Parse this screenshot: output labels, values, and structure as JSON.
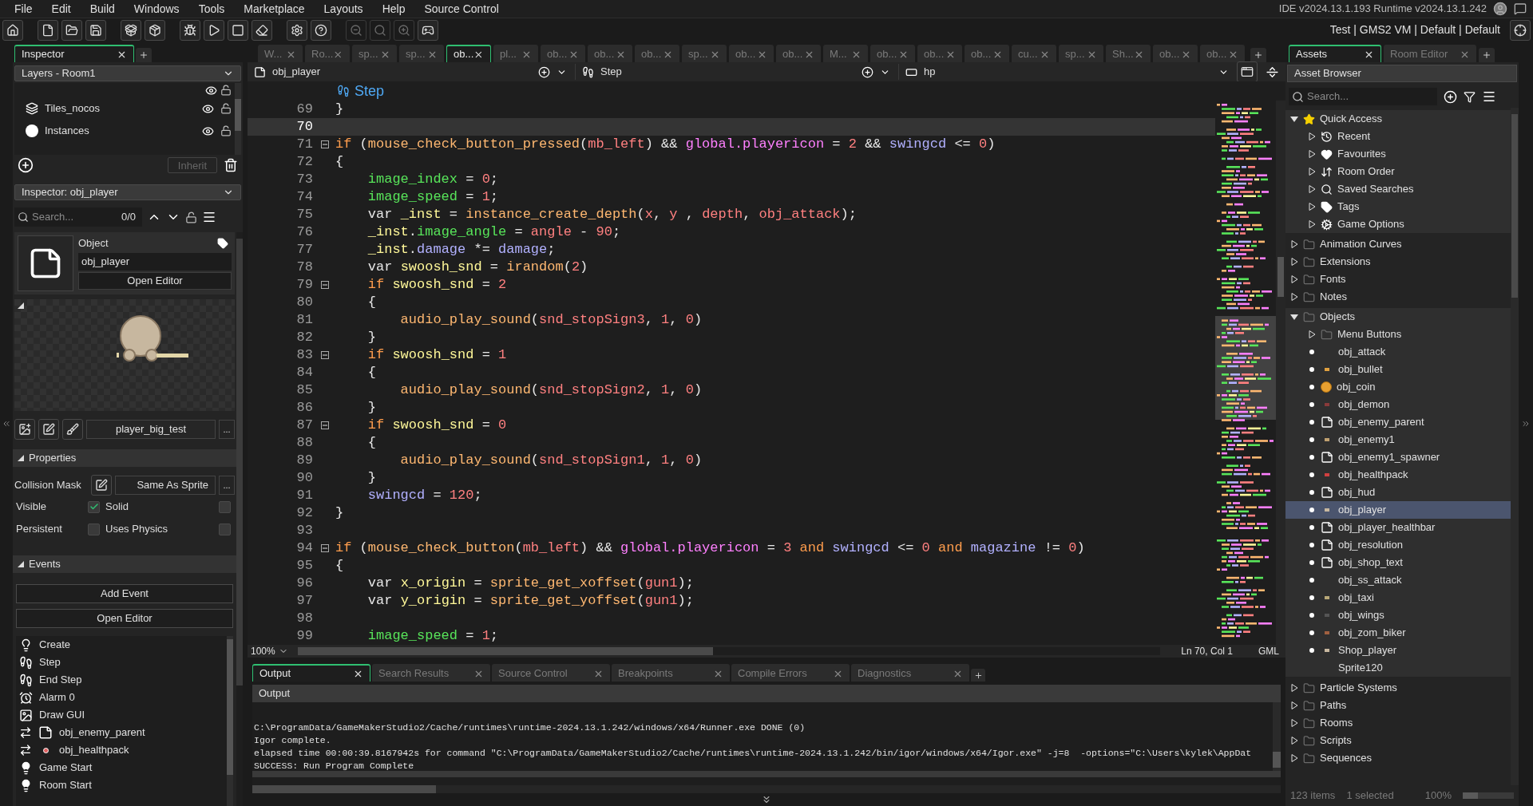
{
  "menu": [
    "File",
    "Edit",
    "Build",
    "Windows",
    "Tools",
    "Marketplace",
    "Layouts",
    "Help",
    "Source Control"
  ],
  "version": "IDE v2024.13.1.193  Runtime v2024.13.1.242",
  "targets": "Test | GMS2 VM | Default | Default",
  "left_panel": {
    "tabs": [
      {
        "label": "Inspector",
        "selected": true
      }
    ],
    "layers_dropdown": "Layers - Room1",
    "layers": [
      {
        "name": "Tiles_nocos",
        "kind": "tiles"
      },
      {
        "name": "Instances",
        "kind": "instances"
      }
    ],
    "inherit_button": {
      "label": "Inherit",
      "disabled": true
    },
    "inspector_dropdown": "Inspector: obj_player",
    "search": {
      "placeholder": "Search...",
      "count": "0/0"
    },
    "object": {
      "type_label": "Object",
      "name": "obj_player",
      "open_button": "Open Editor"
    },
    "sprite_button": "player_big_test",
    "sprite_more": "...",
    "properties": {
      "title": "Properties",
      "expanded": true,
      "collision_label": "Collision Mask",
      "collision_value": "Same As Sprite",
      "collision_more": "...",
      "checks": [
        {
          "label": "Visible",
          "checked": true
        },
        {
          "label": "Solid",
          "checked": false
        },
        {
          "label": "Persistent",
          "checked": false
        },
        {
          "label": "Uses Physics",
          "checked": false
        }
      ]
    },
    "events": {
      "title": "Events",
      "expanded": true,
      "add_button": "Add Event",
      "open_button": "Open Editor",
      "items": [
        {
          "label": "Create",
          "kind": "create"
        },
        {
          "label": "Step",
          "kind": "step"
        },
        {
          "label": "End Step",
          "kind": "step"
        },
        {
          "label": "Alarm 0",
          "kind": "alarm"
        },
        {
          "label": "Draw GUI",
          "kind": "draw"
        },
        {
          "label": "obj_enemy_parent",
          "kind": "collision-object"
        },
        {
          "label": "obj_healthpack",
          "kind": "collision-sprite"
        },
        {
          "label": "Game Start",
          "kind": "other"
        },
        {
          "label": "Room Start",
          "kind": "other"
        }
      ]
    }
  },
  "editor": {
    "tabs": [
      {
        "label": "W...",
        "selected": false
      },
      {
        "label": "Ro...",
        "selected": false
      },
      {
        "label": "sp...",
        "selected": false
      },
      {
        "label": "sp...",
        "selected": false
      },
      {
        "label": "ob...",
        "selected": true
      },
      {
        "label": "pl...",
        "selected": false
      },
      {
        "label": "ob...",
        "selected": false
      },
      {
        "label": "ob...",
        "selected": false
      },
      {
        "label": "ob...",
        "selected": false
      },
      {
        "label": "sp...",
        "selected": false
      },
      {
        "label": "ob...",
        "selected": false
      },
      {
        "label": "ob...",
        "selected": false
      },
      {
        "label": "M...",
        "selected": false
      },
      {
        "label": "ob...",
        "selected": false
      },
      {
        "label": "ob...",
        "selected": false
      },
      {
        "label": "ob...",
        "selected": false
      },
      {
        "label": "cu...",
        "selected": false
      },
      {
        "label": "sp...",
        "selected": false
      },
      {
        "label": "Sh...",
        "selected": false
      },
      {
        "label": "ob...",
        "selected": false
      },
      {
        "label": "ob...",
        "selected": false
      }
    ],
    "object_name": "obj_player",
    "event_name": "Step",
    "variable": "hp",
    "step_title": "Step",
    "lines": [
      {
        "number": "69",
        "current": false,
        "foldable": false,
        "tokens": [
          {
            "text": "}",
            "kind": "plain"
          }
        ]
      },
      {
        "number": "70",
        "current": true,
        "foldable": false
      },
      {
        "number": "71",
        "current": false,
        "foldable": true,
        "tokens": [
          {
            "text": "if",
            "kind": "keyword"
          },
          {
            "text": " (",
            "kind": "plain"
          },
          {
            "text": "mouse_check_button_pressed",
            "kind": "func"
          },
          {
            "text": "(",
            "kind": "plain"
          },
          {
            "text": "mb_left",
            "kind": "constant"
          },
          {
            "text": ") && ",
            "kind": "plain"
          },
          {
            "text": "global.playericon",
            "kind": "global"
          },
          {
            "text": " = ",
            "kind": "plain"
          },
          {
            "text": "2",
            "kind": "number"
          },
          {
            "text": " && ",
            "kind": "plain"
          },
          {
            "text": "swingcd",
            "kind": "instance"
          },
          {
            "text": " <= ",
            "kind": "plain"
          },
          {
            "text": "0",
            "kind": "number"
          },
          {
            "text": ")",
            "kind": "plain"
          }
        ]
      },
      {
        "number": "72",
        "current": false,
        "foldable": false,
        "tokens": [
          {
            "text": "{",
            "kind": "plain"
          }
        ]
      },
      {
        "number": "73",
        "current": false,
        "foldable": false,
        "tokens": [
          {
            "text": "    image_index",
            "kind": "builtin"
          },
          {
            "text": " = ",
            "kind": "plain"
          },
          {
            "text": "0",
            "kind": "number"
          },
          {
            "text": ";",
            "kind": "plain"
          }
        ]
      },
      {
        "number": "74",
        "current": false,
        "foldable": false,
        "tokens": [
          {
            "text": "    image_speed",
            "kind": "builtin"
          },
          {
            "text": " = ",
            "kind": "plain"
          },
          {
            "text": "1",
            "kind": "number"
          },
          {
            "text": ";",
            "kind": "plain"
          }
        ]
      },
      {
        "number": "75",
        "current": false,
        "foldable": false,
        "tokens": [
          {
            "text": "    var ",
            "kind": "plain"
          },
          {
            "text": "_inst",
            "kind": "local"
          },
          {
            "text": " = ",
            "kind": "plain"
          },
          {
            "text": "instance_create_depth",
            "kind": "func"
          },
          {
            "text": "(",
            "kind": "plain"
          },
          {
            "text": "x",
            "kind": "constant"
          },
          {
            "text": ", ",
            "kind": "plain"
          },
          {
            "text": "y",
            "kind": "constant"
          },
          {
            "text": " , ",
            "kind": "plain"
          },
          {
            "text": "depth",
            "kind": "constant"
          },
          {
            "text": ", ",
            "kind": "plain"
          },
          {
            "text": "obj_attack",
            "kind": "constant"
          },
          {
            "text": ");",
            "kind": "plain"
          }
        ]
      },
      {
        "number": "76",
        "current": false,
        "foldable": false,
        "tokens": [
          {
            "text": "    _inst",
            "kind": "local"
          },
          {
            "text": ".",
            "kind": "plain"
          },
          {
            "text": "image_angle",
            "kind": "builtin"
          },
          {
            "text": " = ",
            "kind": "plain"
          },
          {
            "text": "angle",
            "kind": "constant"
          },
          {
            "text": " - ",
            "kind": "plain"
          },
          {
            "text": "90",
            "kind": "number"
          },
          {
            "text": ";",
            "kind": "plain"
          }
        ]
      },
      {
        "number": "77",
        "current": false,
        "foldable": false,
        "tokens": [
          {
            "text": "    _inst",
            "kind": "local"
          },
          {
            "text": ".",
            "kind": "plain"
          },
          {
            "text": "damage",
            "kind": "instance"
          },
          {
            "text": " *= ",
            "kind": "plain"
          },
          {
            "text": "damage",
            "kind": "instance"
          },
          {
            "text": ";",
            "kind": "plain"
          }
        ]
      },
      {
        "number": "78",
        "current": false,
        "foldable": false,
        "tokens": [
          {
            "text": "    var ",
            "kind": "plain"
          },
          {
            "text": "swoosh_snd",
            "kind": "local"
          },
          {
            "text": " = ",
            "kind": "plain"
          },
          {
            "text": "irandom",
            "kind": "func"
          },
          {
            "text": "(",
            "kind": "plain"
          },
          {
            "text": "2",
            "kind": "number"
          },
          {
            "text": ")",
            "kind": "plain"
          }
        ]
      },
      {
        "number": "79",
        "current": false,
        "foldable": true,
        "tokens": [
          {
            "text": "    if",
            "kind": "keyword"
          },
          {
            "text": " swoosh_snd",
            "kind": "local"
          },
          {
            "text": " = ",
            "kind": "plain"
          },
          {
            "text": "2",
            "kind": "number"
          }
        ]
      },
      {
        "number": "80",
        "current": false,
        "foldable": false,
        "tokens": [
          {
            "text": "    {",
            "kind": "plain"
          }
        ]
      },
      {
        "number": "81",
        "current": false,
        "foldable": false,
        "tokens": [
          {
            "text": "        audio_play_sound",
            "kind": "func"
          },
          {
            "text": "(",
            "kind": "plain"
          },
          {
            "text": "snd_stopSign3",
            "kind": "constant"
          },
          {
            "text": ", ",
            "kind": "plain"
          },
          {
            "text": "1",
            "kind": "number"
          },
          {
            "text": ", ",
            "kind": "plain"
          },
          {
            "text": "0",
            "kind": "number"
          },
          {
            "text": ")",
            "kind": "plain"
          }
        ]
      },
      {
        "number": "82",
        "current": false,
        "foldable": false,
        "tokens": [
          {
            "text": "    }",
            "kind": "plain"
          }
        ]
      },
      {
        "number": "83",
        "current": false,
        "foldable": true,
        "tokens": [
          {
            "text": "    if",
            "kind": "keyword"
          },
          {
            "text": " swoosh_snd",
            "kind": "local"
          },
          {
            "text": " = ",
            "kind": "plain"
          },
          {
            "text": "1",
            "kind": "number"
          }
        ]
      },
      {
        "number": "84",
        "current": false,
        "foldable": false,
        "tokens": [
          {
            "text": "    {",
            "kind": "plain"
          }
        ]
      },
      {
        "number": "85",
        "current": false,
        "foldable": false,
        "tokens": [
          {
            "text": "        audio_play_sound",
            "kind": "func"
          },
          {
            "text": "(",
            "kind": "plain"
          },
          {
            "text": "snd_stopSign2",
            "kind": "constant"
          },
          {
            "text": ", ",
            "kind": "plain"
          },
          {
            "text": "1",
            "kind": "number"
          },
          {
            "text": ", ",
            "kind": "plain"
          },
          {
            "text": "0",
            "kind": "number"
          },
          {
            "text": ")",
            "kind": "plain"
          }
        ]
      },
      {
        "number": "86",
        "current": false,
        "foldable": false,
        "tokens": [
          {
            "text": "    }",
            "kind": "plain"
          }
        ]
      },
      {
        "number": "87",
        "current": false,
        "foldable": true,
        "tokens": [
          {
            "text": "    if",
            "kind": "keyword"
          },
          {
            "text": " swoosh_snd",
            "kind": "local"
          },
          {
            "text": " = ",
            "kind": "plain"
          },
          {
            "text": "0",
            "kind": "number"
          }
        ]
      },
      {
        "number": "88",
        "current": false,
        "foldable": false,
        "tokens": [
          {
            "text": "    {",
            "kind": "plain"
          }
        ]
      },
      {
        "number": "89",
        "current": false,
        "foldable": false,
        "tokens": [
          {
            "text": "        audio_play_sound",
            "kind": "func"
          },
          {
            "text": "(",
            "kind": "plain"
          },
          {
            "text": "snd_stopSign1",
            "kind": "constant"
          },
          {
            "text": ", ",
            "kind": "plain"
          },
          {
            "text": "1",
            "kind": "number"
          },
          {
            "text": ", ",
            "kind": "plain"
          },
          {
            "text": "0",
            "kind": "number"
          },
          {
            "text": ")",
            "kind": "plain"
          }
        ]
      },
      {
        "number": "90",
        "current": false,
        "foldable": false,
        "tokens": [
          {
            "text": "    }",
            "kind": "plain"
          }
        ]
      },
      {
        "number": "91",
        "current": false,
        "foldable": false,
        "tokens": [
          {
            "text": "    swingcd",
            "kind": "instance"
          },
          {
            "text": " = ",
            "kind": "plain"
          },
          {
            "text": "120",
            "kind": "number"
          },
          {
            "text": ";",
            "kind": "plain"
          }
        ]
      },
      {
        "number": "92",
        "current": false,
        "foldable": false,
        "tokens": [
          {
            "text": "}",
            "kind": "plain"
          }
        ]
      },
      {
        "number": "93",
        "current": false,
        "foldable": false
      },
      {
        "number": "94",
        "current": false,
        "foldable": true,
        "tokens": [
          {
            "text": "if",
            "kind": "keyword"
          },
          {
            "text": " (",
            "kind": "plain"
          },
          {
            "text": "mouse_check_button",
            "kind": "func"
          },
          {
            "text": "(",
            "kind": "plain"
          },
          {
            "text": "mb_left",
            "kind": "constant"
          },
          {
            "text": ") && ",
            "kind": "plain"
          },
          {
            "text": "global.playericon",
            "kind": "global"
          },
          {
            "text": " = ",
            "kind": "plain"
          },
          {
            "text": "3",
            "kind": "number"
          },
          {
            "text": " and",
            "kind": "keyword"
          },
          {
            "text": " swingcd",
            "kind": "instance"
          },
          {
            "text": " <= ",
            "kind": "plain"
          },
          {
            "text": "0",
            "kind": "number"
          },
          {
            "text": " and",
            "kind": "keyword"
          },
          {
            "text": " magazine",
            "kind": "instance"
          },
          {
            "text": " != ",
            "kind": "plain"
          },
          {
            "text": "0",
            "kind": "number"
          },
          {
            "text": ")",
            "kind": "plain"
          }
        ]
      },
      {
        "number": "95",
        "current": false,
        "foldable": false,
        "tokens": [
          {
            "text": "{",
            "kind": "plain"
          }
        ]
      },
      {
        "number": "96",
        "current": false,
        "foldable": false,
        "tokens": [
          {
            "text": "    var ",
            "kind": "plain"
          },
          {
            "text": "x_origin",
            "kind": "local"
          },
          {
            "text": " = ",
            "kind": "plain"
          },
          {
            "text": "sprite_get_xoffset",
            "kind": "func"
          },
          {
            "text": "(",
            "kind": "plain"
          },
          {
            "text": "gun1",
            "kind": "constant"
          },
          {
            "text": ");",
            "kind": "plain"
          }
        ]
      },
      {
        "number": "97",
        "current": false,
        "foldable": false,
        "tokens": [
          {
            "text": "    var ",
            "kind": "plain"
          },
          {
            "text": "y_origin",
            "kind": "local"
          },
          {
            "text": " = ",
            "kind": "plain"
          },
          {
            "text": "sprite_get_yoffset",
            "kind": "func"
          },
          {
            "text": "(",
            "kind": "plain"
          },
          {
            "text": "gun1",
            "kind": "constant"
          },
          {
            "text": ");",
            "kind": "plain"
          }
        ]
      },
      {
        "number": "98",
        "current": false,
        "foldable": false
      },
      {
        "number": "99",
        "current": false,
        "foldable": false,
        "tokens": [
          {
            "text": "    image_speed",
            "kind": "builtin"
          },
          {
            "text": " = ",
            "kind": "plain"
          },
          {
            "text": "1",
            "kind": "number"
          },
          {
            "text": ";",
            "kind": "plain"
          }
        ]
      }
    ],
    "zoom": "100%",
    "position": "Ln 70, Col 1",
    "language": "GML"
  },
  "output": {
    "tabs": [
      {
        "label": "Output",
        "selected": true
      },
      {
        "label": "Search Results",
        "selected": false
      },
      {
        "label": "Source Control",
        "selected": false
      },
      {
        "label": "Breakpoints",
        "selected": false
      },
      {
        "label": "Compile Errors",
        "selected": false
      },
      {
        "label": "Diagnostics",
        "selected": false
      }
    ],
    "header": "Output",
    "lines": [
      "C:\\ProgramData/GameMakerStudio2/Cache/runtimes\\runtime-2024.13.1.242/windows/x64/Runner.exe DONE (0)",
      "Igor complete.",
      "elapsed time 00:00:39.8167942s for command \"C:\\ProgramData/GameMakerStudio2/Cache/runtimes\\runtime-2024.13.1.242/bin/igor/windows/x64/Igor.exe\" -j=8  -options=\"C:\\Users\\kylek\\AppDat",
      "SUCCESS: Run Program Complete"
    ]
  },
  "assets": {
    "tabs": [
      {
        "label": "Assets",
        "selected": true
      },
      {
        "label": "Room Editor",
        "selected": false
      }
    ],
    "header": "Asset Browser",
    "search_placeholder": "Search...",
    "tree": [
      {
        "label": "Quick Access",
        "kind": "quick",
        "expanded": true,
        "selected": false,
        "children": [
          {
            "label": "Recent",
            "kind": "recent",
            "expanded": false,
            "selected": false
          },
          {
            "label": "Favourites",
            "kind": "favourites",
            "expanded": false,
            "selected": false
          },
          {
            "label": "Room Order",
            "kind": "room-order",
            "expanded": false,
            "selected": false
          },
          {
            "label": "Saved Searches",
            "kind": "saved-searches",
            "expanded": false,
            "selected": false
          },
          {
            "label": "Tags",
            "kind": "tags",
            "expanded": false,
            "selected": false
          },
          {
            "label": "Game Options",
            "kind": "game-options",
            "expanded": false,
            "selected": false
          }
        ]
      },
      {
        "label": "Animation Curves",
        "kind": "folder",
        "expanded": false,
        "selected": false
      },
      {
        "label": "Extensions",
        "kind": "folder",
        "expanded": false,
        "selected": false
      },
      {
        "label": "Fonts",
        "kind": "folder",
        "expanded": false,
        "selected": false
      },
      {
        "label": "Notes",
        "kind": "folder",
        "expanded": false,
        "selected": false
      },
      {
        "label": "Objects",
        "kind": "folder",
        "expanded": true,
        "selected": false,
        "children": [
          {
            "label": "Menu Buttons",
            "kind": "folder",
            "expanded": false,
            "selected": false
          },
          {
            "label": "obj_attack",
            "kind": "object-plain",
            "selected": false
          },
          {
            "label": "obj_bullet",
            "kind": "object-sprite",
            "color": "#e0a040",
            "selected": false
          },
          {
            "label": "obj_coin",
            "kind": "object-coin",
            "selected": false
          },
          {
            "label": "obj_demon",
            "kind": "object-sprite",
            "color": "#8a3a3a",
            "selected": false
          },
          {
            "label": "obj_enemy_parent",
            "kind": "object",
            "selected": false
          },
          {
            "label": "obj_enemy1",
            "kind": "object-sprite",
            "color": "#c0a070",
            "selected": false
          },
          {
            "label": "obj_enemy1_spawner",
            "kind": "object",
            "selected": false
          },
          {
            "label": "obj_healthpack",
            "kind": "object-sprite",
            "color": "#d04040",
            "selected": false
          },
          {
            "label": "obj_hud",
            "kind": "object",
            "selected": false
          },
          {
            "label": "obj_player",
            "kind": "object-sprite",
            "color": "#c8b8a0",
            "selected": true
          },
          {
            "label": "obj_player_healthbar",
            "kind": "object",
            "selected": false
          },
          {
            "label": "obj_resolution",
            "kind": "object",
            "selected": false
          },
          {
            "label": "obj_shop_text",
            "kind": "object",
            "selected": false
          },
          {
            "label": "obj_ss_attack",
            "kind": "object-plain",
            "selected": false
          },
          {
            "label": "obj_taxi",
            "kind": "object-sprite",
            "color": "#b8a878",
            "selected": false
          },
          {
            "label": "obj_wings",
            "kind": "object-sprite",
            "color": "#555555",
            "selected": false
          },
          {
            "label": "obj_zom_biker",
            "kind": "object-sprite",
            "color": "#a06040",
            "selected": false
          },
          {
            "label": "Shop_player",
            "kind": "object-sprite",
            "color": "#c8b8a0",
            "selected": false
          },
          {
            "label": "Sprite120",
            "kind": "sprite",
            "selected": false
          }
        ]
      },
      {
        "label": "Particle Systems",
        "kind": "folder",
        "expanded": false,
        "selected": false
      },
      {
        "label": "Paths",
        "kind": "folder",
        "expanded": false,
        "selected": false
      },
      {
        "label": "Rooms",
        "kind": "folder",
        "expanded": false,
        "selected": false
      },
      {
        "label": "Scripts",
        "kind": "folder",
        "expanded": false,
        "selected": false
      },
      {
        "label": "Sequences",
        "kind": "folder",
        "expanded": false,
        "selected": false
      }
    ],
    "item_count": "123 items",
    "selection": "1 selected",
    "zoom": "100%",
    "zoom_slider": {
      "level": 0.3
    }
  }
}
